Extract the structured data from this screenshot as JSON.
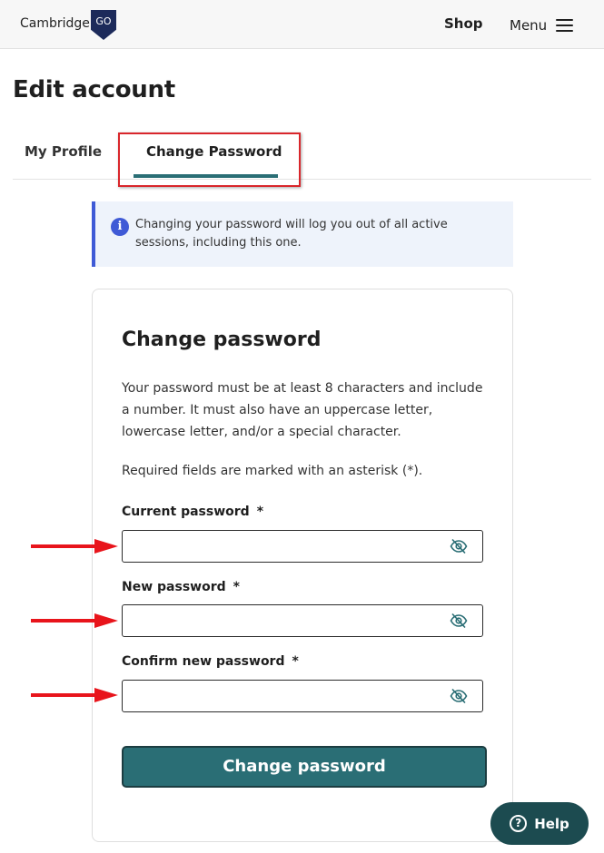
{
  "header": {
    "logo_text": "Cambridge",
    "logo_badge": "GO",
    "shop_label": "Shop",
    "menu_label": "Menu"
  },
  "page": {
    "title": "Edit account"
  },
  "tabs": [
    {
      "label": "My Profile",
      "active": false
    },
    {
      "label": "Change Password",
      "active": true
    }
  ],
  "info": {
    "icon": "info-icon",
    "text": "Changing your password will log you out of all active sessions, including this one."
  },
  "form": {
    "title": "Change password",
    "description": "Your password must be at least 8 characters and include a number. It must also have an uppercase letter, lowercase letter, and/or a special character.",
    "required_note": "Required fields are marked with an asterisk (*).",
    "fields": [
      {
        "label": "Current password",
        "asterisk": "*",
        "value": ""
      },
      {
        "label": "New password",
        "asterisk": "*",
        "value": ""
      },
      {
        "label": "Confirm new password",
        "asterisk": "*",
        "value": ""
      }
    ],
    "submit_label": "Change password"
  },
  "help": {
    "label": "Help"
  },
  "colors": {
    "accent_teal": "#2a6e75",
    "info_blue": "#3f5ad6",
    "annotation_red": "#d9262b"
  }
}
